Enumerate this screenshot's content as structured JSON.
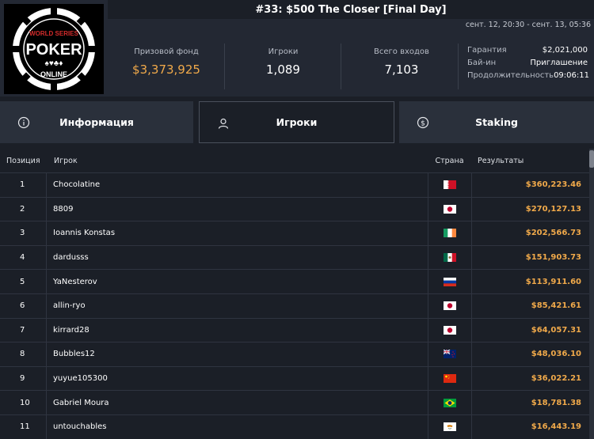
{
  "tournament": {
    "title": "#33: $500 The Closer [Final Day]",
    "dates": "сент. 12, 20:30 - сент. 13, 05:36"
  },
  "logo": {
    "line1": "WORLD SERIES",
    "line2": "POKER",
    "line3": "ONLINE"
  },
  "stats": {
    "prize_label": "Призовой фонд",
    "prize_value": "$3,373,925",
    "players_label": "Игроки",
    "players_value": "1,089",
    "entries_label": "Всего входов",
    "entries_value": "7,103"
  },
  "meta": {
    "guarantee_label": "Гарантия",
    "guarantee_value": "$2,021,000",
    "buyin_label": "Бай-ин",
    "buyin_value": "Приглашение",
    "duration_label": "Продолжительность",
    "duration_value": "09:06:11"
  },
  "tabs": [
    {
      "label": "Информация",
      "icon": "info-icon"
    },
    {
      "label": "Игроки",
      "icon": "user-icon"
    },
    {
      "label": "Staking",
      "icon": "dollar-coin-icon"
    }
  ],
  "table": {
    "headers": {
      "position": "Позиция",
      "player": "Игрок",
      "country": "Страна",
      "results": "Результаты"
    },
    "rows": [
      {
        "pos": "1",
        "name": "Chocolatine",
        "flag": "bahrain",
        "result": "$360,223.46"
      },
      {
        "pos": "2",
        "name": "8809",
        "flag": "japan",
        "result": "$270,127.13"
      },
      {
        "pos": "3",
        "name": "Ioannis Konstas",
        "flag": "ireland",
        "result": "$202,566.73"
      },
      {
        "pos": "4",
        "name": "dardusss",
        "flag": "mexico",
        "result": "$151,903.73"
      },
      {
        "pos": "5",
        "name": "YaNesterov",
        "flag": "russia",
        "result": "$113,911.60"
      },
      {
        "pos": "6",
        "name": "allin-ryo",
        "flag": "japan",
        "result": "$85,421.61"
      },
      {
        "pos": "7",
        "name": "kirrard28",
        "flag": "japan",
        "result": "$64,057.31"
      },
      {
        "pos": "8",
        "name": "Bubbles12",
        "flag": "new-zealand",
        "result": "$48,036.10"
      },
      {
        "pos": "9",
        "name": "yuyue105300",
        "flag": "china",
        "result": "$36,022.21"
      },
      {
        "pos": "10",
        "name": "Gabriel Moura",
        "flag": "brazil",
        "result": "$18,781.38"
      },
      {
        "pos": "11",
        "name": "untouchables",
        "flag": "cyprus",
        "result": "$16,443.19"
      }
    ]
  },
  "colors": {
    "background": "#1b1f27",
    "panel": "#232833",
    "tab": "#2a303b",
    "accent_gold": "#f0a94a"
  }
}
